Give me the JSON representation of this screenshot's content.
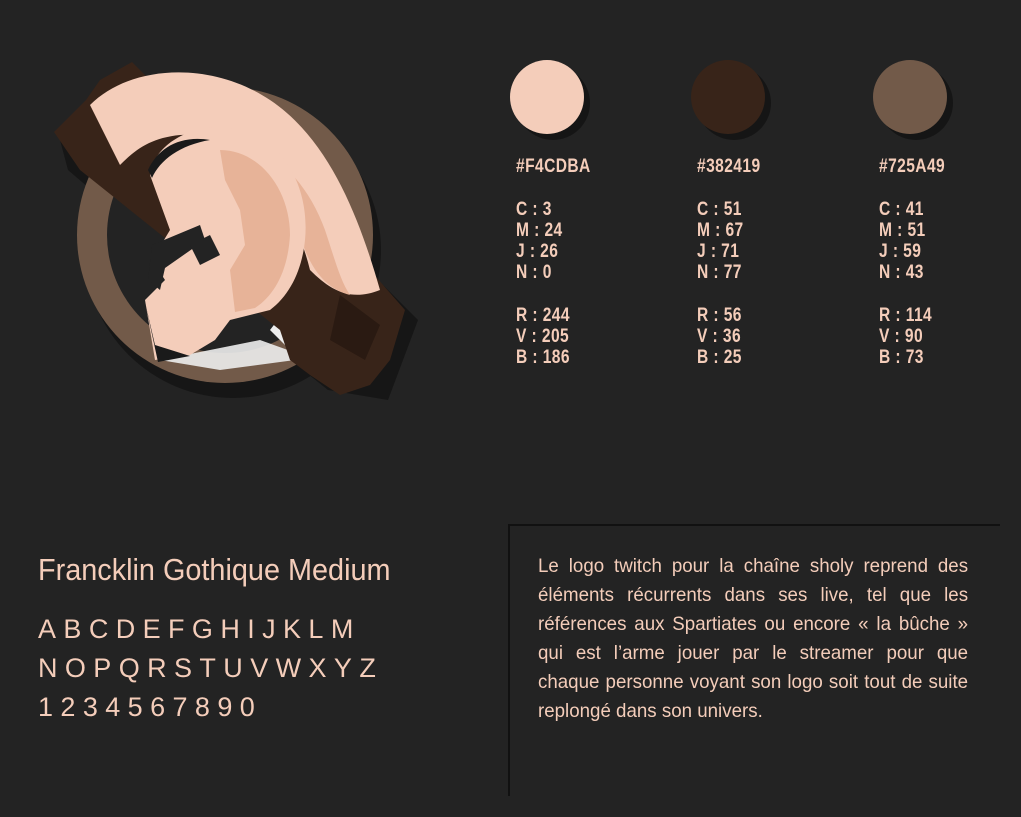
{
  "swatches": [
    {
      "hex": "#F4CDBA",
      "c": "C : 3",
      "m": "M : 24",
      "j": "J : 26",
      "n": "N : 0",
      "r": "R : 244",
      "v": "V : 205",
      "b": "B : 186",
      "color": "#F4CDBA"
    },
    {
      "hex": "#382419",
      "c": "C : 51",
      "m": "M : 67",
      "j": "J : 71",
      "n": "N : 77",
      "r": "R : 56",
      "v": "V : 36",
      "b": "B : 25",
      "color": "#382419"
    },
    {
      "hex": "#725A49",
      "c": "C : 41",
      "m": "M : 51",
      "j": "J : 59",
      "n": "N : 43",
      "r": "R : 114",
      "v": "V : 90",
      "b": "B : 73",
      "color": "#725A49"
    }
  ],
  "font": {
    "title": "Francklin Gothique Medium",
    "row1": "ABCDEFGHIJKLM",
    "row2": "NOPQRSTUVWXYZ",
    "row3": "1234567890"
  },
  "description": "Le logo twitch pour la chaîne sholy reprend des éléments récurrents dans ses live, tel que les références aux Spartiates ou encore « la bûche » qui est l’arme jouer par le streamer pour que chaque personne voyant son logo soit tout de suite replongé dans son univers.",
  "logo_icon": "spartan-helmet-log-icon",
  "colors": {
    "background": "#232323",
    "light": "#F4CDBA",
    "dark": "#382419",
    "mid": "#725A49",
    "white": "#EDEDED"
  }
}
